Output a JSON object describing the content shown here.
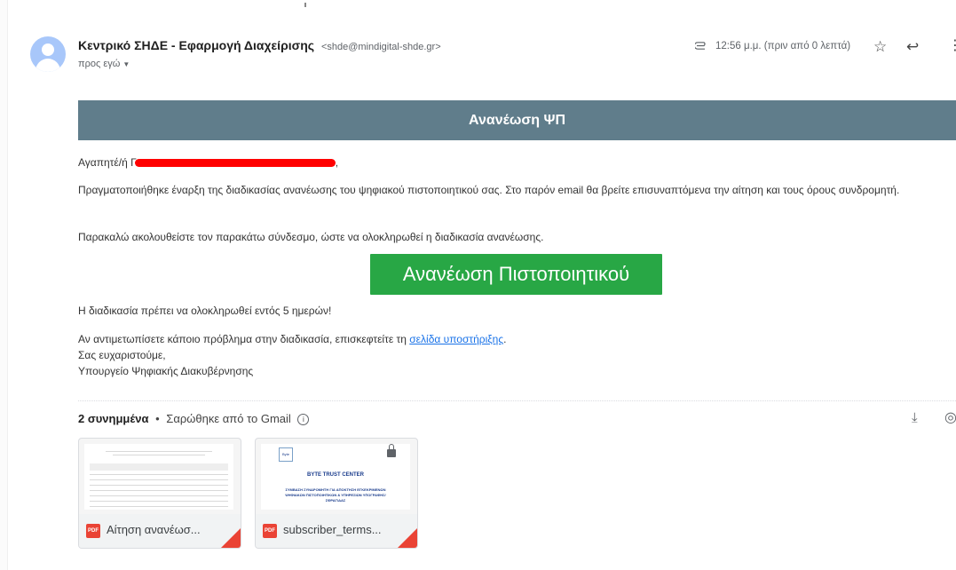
{
  "email": {
    "sender_name": "Κεντρικό ΣΗΔΕ - Εφαρμογή Διαχείρισης",
    "sender_email": "<shde@mindigital-shde.gr>",
    "to_label": "προς εγώ",
    "time": "12:56 μ.μ. (πριν από 0 λεπτά)"
  },
  "body": {
    "banner": "Ανανέωση ΨΠ",
    "greeting": "Αγαπητέ/ή Γ",
    "greeting_end": ",",
    "para1": "Πραγματοποιήθηκε έναρξη της διαδικασίας ανανέωσης του ψηφιακού πιστοποιητικού σας. Στο παρόν email θα βρείτε επισυναπτόμενα την αίτηση και τους όρους συνδρομητή.",
    "para2": "Παρακαλώ ακολουθείστε τον παρακάτω σύνδεσμο, ώστε να ολοκληρωθεί η διαδικασία ανανέωσης.",
    "cta_label": "Ανανέωση Πιστοποιητικού",
    "para3": "Η διαδικασία πρέπει να ολοκληρωθεί εντός 5 ημερών!",
    "para4_prefix": "Αν αντιμετωπίσετε κάποιο πρόβλημα στην διαδικασία, επισκεφτείτε τη ",
    "support_link": "σελίδα υποστήριξης",
    "para4_suffix": ".",
    "thanks": "Σας ευχαριστούμε,",
    "signature": "Υπουργείο Ψηφιακής Διακυβέρνησης"
  },
  "attachments": {
    "count_label": "2 συνημμένα",
    "separator": "•",
    "scan_label": "Σαρώθηκε από το Gmail",
    "info_glyph": "i",
    "items": [
      {
        "badge": "PDF",
        "name": "Αίτηση ανανέωσ..."
      },
      {
        "badge": "PDF",
        "name": "subscriber_terms...",
        "doc_heading": "BYTE TRUST CENTER",
        "doc_logo": "Byte",
        "doc_subtitle": "ΣΥΜΒΑΣΗ ΣΥΝΔΡΟΜΗΤΗ ΓΙΑ ΑΠΟΚΤΗΣΗ ΕΓΚΕΚΡΙΜΕΝΩΝ ΨΗΦΙΑΚΩΝ ΠΙΣΤΟΠΟΙΗΤΙΚΩΝ & ΥΠΗΡΕΣΙΩΝ ΥΠΟΓΡΑΦΗΣ/ΣΦΡΑΓΙΔΑΣ"
      }
    ]
  },
  "icons": {
    "star": "☆",
    "reply": "↩",
    "more": "⋮",
    "download": "⤓",
    "drive": "◎",
    "caret": "▼"
  },
  "colors": {
    "banner": "#607d8b",
    "cta": "#28a745",
    "redaction": "#ff0000",
    "pdf": "#ea4335",
    "link": "#1a73e8"
  }
}
